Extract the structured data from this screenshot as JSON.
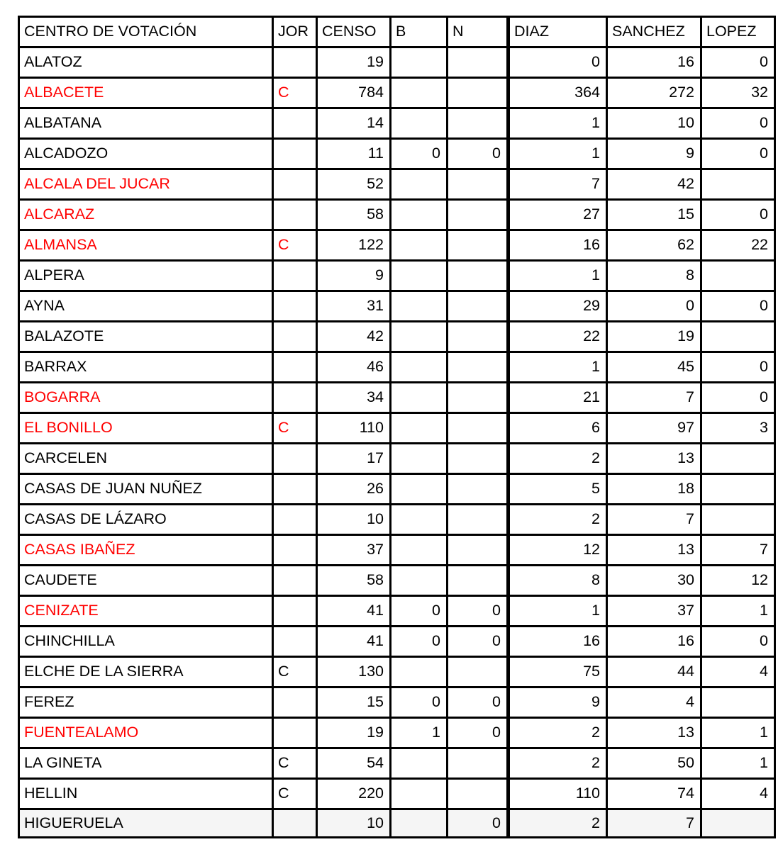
{
  "table": {
    "columns": [
      {
        "key": "centro",
        "label": "CENTRO DE VOTACIÓN",
        "align": "left"
      },
      {
        "key": "jor",
        "label": "JOR",
        "align": "left"
      },
      {
        "key": "censo",
        "label": "CENSO",
        "align": "right"
      },
      {
        "key": "b",
        "label": "B",
        "align": "right"
      },
      {
        "key": "n",
        "label": "N",
        "align": "right"
      },
      {
        "key": "diaz",
        "label": "DIAZ",
        "align": "right"
      },
      {
        "key": "sanchez",
        "label": "SANCHEZ",
        "align": "right"
      },
      {
        "key": "lopez",
        "label": "LOPEZ",
        "align": "right"
      }
    ],
    "colors": {
      "highlight_name": "#ff0000",
      "normal_name": "#000000",
      "grid": "#000000",
      "shaded_row_bg": "#f5f5f5"
    },
    "rows": [
      {
        "centro": "ALATOZ",
        "highlight": false,
        "jor": "",
        "censo": "19",
        "b": "",
        "n": "",
        "diaz": "0",
        "sanchez": "16",
        "lopez": "0",
        "shaded": false
      },
      {
        "centro": "ALBACETE",
        "highlight": true,
        "jor": "C",
        "censo": "784",
        "b": "",
        "n": "",
        "diaz": "364",
        "sanchez": "272",
        "lopez": "32",
        "shaded": false
      },
      {
        "centro": "ALBATANA",
        "highlight": false,
        "jor": "",
        "censo": "14",
        "b": "",
        "n": "",
        "diaz": "1",
        "sanchez": "10",
        "lopez": "0",
        "shaded": false
      },
      {
        "centro": "ALCADOZO",
        "highlight": false,
        "jor": "",
        "censo": "11",
        "b": "0",
        "n": "0",
        "diaz": "1",
        "sanchez": "9",
        "lopez": "0",
        "shaded": false
      },
      {
        "centro": "ALCALA DEL JUCAR",
        "highlight": true,
        "jor": "",
        "censo": "52",
        "b": "",
        "n": "",
        "diaz": "7",
        "sanchez": "42",
        "lopez": "",
        "shaded": false
      },
      {
        "centro": "ALCARAZ",
        "highlight": true,
        "jor": "",
        "censo": "58",
        "b": "",
        "n": "",
        "diaz": "27",
        "sanchez": "15",
        "lopez": "0",
        "shaded": false
      },
      {
        "centro": "ALMANSA",
        "highlight": true,
        "jor": "C",
        "censo": "122",
        "b": "",
        "n": "",
        "diaz": "16",
        "sanchez": "62",
        "lopez": "22",
        "shaded": false
      },
      {
        "centro": "ALPERA",
        "highlight": false,
        "jor": "",
        "censo": "9",
        "b": "",
        "n": "",
        "diaz": "1",
        "sanchez": "8",
        "lopez": "",
        "shaded": false
      },
      {
        "centro": "AYNA",
        "highlight": false,
        "jor": "",
        "censo": "31",
        "b": "",
        "n": "",
        "diaz": "29",
        "sanchez": "0",
        "lopez": "0",
        "shaded": false
      },
      {
        "centro": "BALAZOTE",
        "highlight": false,
        "jor": "",
        "censo": "42",
        "b": "",
        "n": "",
        "diaz": "22",
        "sanchez": "19",
        "lopez": "",
        "shaded": false
      },
      {
        "centro": "BARRAX",
        "highlight": false,
        "jor": "",
        "censo": "46",
        "b": "",
        "n": "",
        "diaz": "1",
        "sanchez": "45",
        "lopez": "0",
        "shaded": false
      },
      {
        "centro": "BOGARRA",
        "highlight": true,
        "jor": "",
        "censo": "34",
        "b": "",
        "n": "",
        "diaz": "21",
        "sanchez": "7",
        "lopez": "0",
        "shaded": false
      },
      {
        "centro": "EL BONILLO",
        "highlight": true,
        "jor": "C",
        "censo": "110",
        "b": "",
        "n": "",
        "diaz": "6",
        "sanchez": "97",
        "lopez": "3",
        "shaded": false
      },
      {
        "centro": "CARCELEN",
        "highlight": false,
        "jor": "",
        "censo": "17",
        "b": "",
        "n": "",
        "diaz": "2",
        "sanchez": "13",
        "lopez": "",
        "shaded": false
      },
      {
        "centro": "CASAS DE JUAN NUÑEZ",
        "highlight": false,
        "jor": "",
        "censo": "26",
        "b": "",
        "n": "",
        "diaz": "5",
        "sanchez": "18",
        "lopez": "",
        "shaded": false
      },
      {
        "centro": "CASAS DE LÁZARO",
        "highlight": false,
        "jor": "",
        "censo": "10",
        "b": "",
        "n": "",
        "diaz": "2",
        "sanchez": "7",
        "lopez": "",
        "shaded": false
      },
      {
        "centro": "CASAS IBAÑEZ",
        "highlight": true,
        "jor": "",
        "censo": "37",
        "b": "",
        "n": "",
        "diaz": "12",
        "sanchez": "13",
        "lopez": "7",
        "shaded": false
      },
      {
        "centro": "CAUDETE",
        "highlight": false,
        "jor": "",
        "censo": "58",
        "b": "",
        "n": "",
        "diaz": "8",
        "sanchez": "30",
        "lopez": "12",
        "shaded": false
      },
      {
        "centro": "CENIZATE",
        "highlight": true,
        "jor": "",
        "censo": "41",
        "b": "0",
        "n": "0",
        "diaz": "1",
        "sanchez": "37",
        "lopez": "1",
        "shaded": false
      },
      {
        "centro": "CHINCHILLA",
        "highlight": false,
        "jor": "",
        "censo": "41",
        "b": "0",
        "n": "0",
        "diaz": "16",
        "sanchez": "16",
        "lopez": "0",
        "shaded": false
      },
      {
        "centro": "ELCHE DE LA SIERRA",
        "highlight": false,
        "jor": "C",
        "censo": "130",
        "b": "",
        "n": "",
        "diaz": "75",
        "sanchez": "44",
        "lopez": "4",
        "shaded": false
      },
      {
        "centro": "FEREZ",
        "highlight": false,
        "jor": "",
        "censo": "15",
        "b": "0",
        "n": "0",
        "diaz": "9",
        "sanchez": "4",
        "lopez": "",
        "shaded": false
      },
      {
        "centro": "FUENTEALAMO",
        "highlight": true,
        "jor": "",
        "censo": "19",
        "b": "1",
        "n": "0",
        "diaz": "2",
        "sanchez": "13",
        "lopez": "1",
        "shaded": false
      },
      {
        "centro": "LA GINETA",
        "highlight": false,
        "jor": "C",
        "censo": "54",
        "b": "",
        "n": "",
        "diaz": "2",
        "sanchez": "50",
        "lopez": "1",
        "shaded": false
      },
      {
        "centro": "HELLIN",
        "highlight": false,
        "jor": "C",
        "censo": "220",
        "b": "",
        "n": "",
        "diaz": "110",
        "sanchez": "74",
        "lopez": "4",
        "shaded": false
      },
      {
        "centro": "HIGUERUELA",
        "highlight": false,
        "jor": "",
        "censo": "10",
        "b": "",
        "n": "0",
        "diaz": "2",
        "sanchez": "7",
        "lopez": "",
        "shaded": true
      }
    ]
  }
}
